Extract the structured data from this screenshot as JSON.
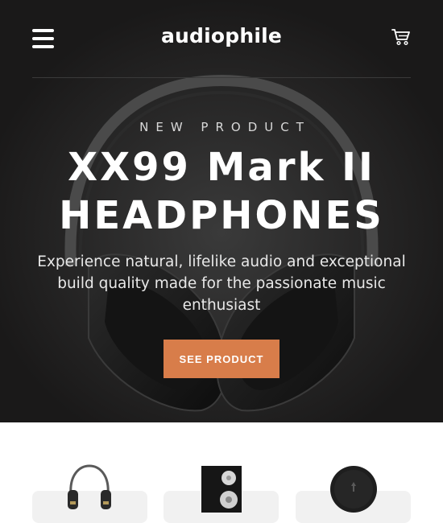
{
  "header": {
    "logo": "audiophile",
    "menu_icon": "hamburger-menu-icon",
    "cart_icon": "cart-icon"
  },
  "hero": {
    "overline": "NEW PRODUCT",
    "title_line1": "XX99 Mark II",
    "title_line2": "HEADPHONES",
    "description": "Experience natural, lifelike audio and exceptional build quality made for the passionate music enthusiast",
    "cta_label": "SEE PRODUCT",
    "image": "headphones-image"
  },
  "categories": [
    {
      "icon": "headphones-thumbnail"
    },
    {
      "icon": "speaker-thumbnail"
    },
    {
      "icon": "earphones-thumbnail"
    }
  ],
  "colors": {
    "hero_background": "#1a1919",
    "accent": "#d87d4a",
    "card_background": "#f1f1f1"
  }
}
